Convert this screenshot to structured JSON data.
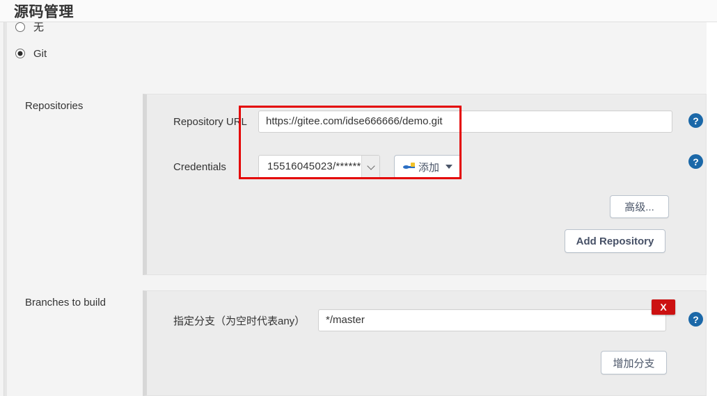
{
  "header": {
    "title": "源码管理"
  },
  "scm_options": [
    {
      "label": "无",
      "selected": false
    },
    {
      "label": "Git",
      "selected": true
    }
  ],
  "repositories": {
    "section_label": "Repositories",
    "repository_url": {
      "label": "Repository URL",
      "value": "https://gitee.com/idse666666/demo.git",
      "placeholder": ""
    },
    "credentials": {
      "label": "Credentials",
      "selected": "15516045023/******",
      "add_button": "添加",
      "add_icon": "key-icon",
      "caret": "chevron-down-icon"
    },
    "advanced_button": "高级...",
    "add_repository_button": "Add Repository",
    "help_icon": "?"
  },
  "branches": {
    "section_label": "Branches to build",
    "branch_spec": {
      "label": "指定分支（为空时代表any）",
      "value": "*/master"
    },
    "delete_badge": "X",
    "add_branch_button": "增加分支",
    "help_icon": "?"
  },
  "colors": {
    "highlight_border": "#e40000",
    "help_blue": "#1b68a8",
    "delete_red": "#cc1111",
    "panel_bg": "#ececec",
    "page_bg": "#f4f4f4"
  }
}
